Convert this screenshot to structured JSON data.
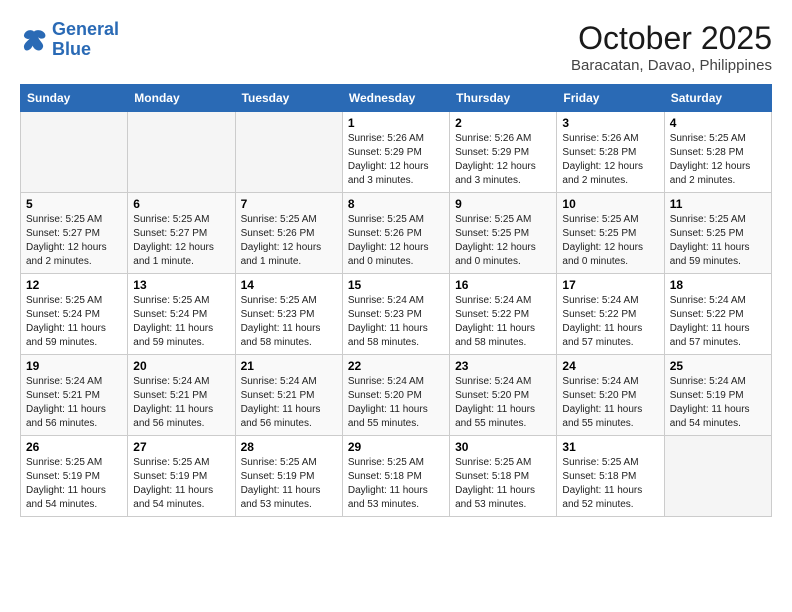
{
  "logo": {
    "line1": "General",
    "line2": "Blue"
  },
  "title": "October 2025",
  "location": "Baracatan, Davao, Philippines",
  "weekdays": [
    "Sunday",
    "Monday",
    "Tuesday",
    "Wednesday",
    "Thursday",
    "Friday",
    "Saturday"
  ],
  "weeks": [
    [
      {
        "day": "",
        "empty": true
      },
      {
        "day": "",
        "empty": true
      },
      {
        "day": "",
        "empty": true
      },
      {
        "day": "1",
        "sunrise": "5:26 AM",
        "sunset": "5:29 PM",
        "daylight": "12 hours and 3 minutes."
      },
      {
        "day": "2",
        "sunrise": "5:26 AM",
        "sunset": "5:29 PM",
        "daylight": "12 hours and 3 minutes."
      },
      {
        "day": "3",
        "sunrise": "5:26 AM",
        "sunset": "5:28 PM",
        "daylight": "12 hours and 2 minutes."
      },
      {
        "day": "4",
        "sunrise": "5:25 AM",
        "sunset": "5:28 PM",
        "daylight": "12 hours and 2 minutes."
      }
    ],
    [
      {
        "day": "5",
        "sunrise": "5:25 AM",
        "sunset": "5:27 PM",
        "daylight": "12 hours and 2 minutes."
      },
      {
        "day": "6",
        "sunrise": "5:25 AM",
        "sunset": "5:27 PM",
        "daylight": "12 hours and 1 minute."
      },
      {
        "day": "7",
        "sunrise": "5:25 AM",
        "sunset": "5:26 PM",
        "daylight": "12 hours and 1 minute."
      },
      {
        "day": "8",
        "sunrise": "5:25 AM",
        "sunset": "5:26 PM",
        "daylight": "12 hours and 0 minutes."
      },
      {
        "day": "9",
        "sunrise": "5:25 AM",
        "sunset": "5:25 PM",
        "daylight": "12 hours and 0 minutes."
      },
      {
        "day": "10",
        "sunrise": "5:25 AM",
        "sunset": "5:25 PM",
        "daylight": "12 hours and 0 minutes."
      },
      {
        "day": "11",
        "sunrise": "5:25 AM",
        "sunset": "5:25 PM",
        "daylight": "11 hours and 59 minutes."
      }
    ],
    [
      {
        "day": "12",
        "sunrise": "5:25 AM",
        "sunset": "5:24 PM",
        "daylight": "11 hours and 59 minutes."
      },
      {
        "day": "13",
        "sunrise": "5:25 AM",
        "sunset": "5:24 PM",
        "daylight": "11 hours and 59 minutes."
      },
      {
        "day": "14",
        "sunrise": "5:25 AM",
        "sunset": "5:23 PM",
        "daylight": "11 hours and 58 minutes."
      },
      {
        "day": "15",
        "sunrise": "5:24 AM",
        "sunset": "5:23 PM",
        "daylight": "11 hours and 58 minutes."
      },
      {
        "day": "16",
        "sunrise": "5:24 AM",
        "sunset": "5:22 PM",
        "daylight": "11 hours and 58 minutes."
      },
      {
        "day": "17",
        "sunrise": "5:24 AM",
        "sunset": "5:22 PM",
        "daylight": "11 hours and 57 minutes."
      },
      {
        "day": "18",
        "sunrise": "5:24 AM",
        "sunset": "5:22 PM",
        "daylight": "11 hours and 57 minutes."
      }
    ],
    [
      {
        "day": "19",
        "sunrise": "5:24 AM",
        "sunset": "5:21 PM",
        "daylight": "11 hours and 56 minutes."
      },
      {
        "day": "20",
        "sunrise": "5:24 AM",
        "sunset": "5:21 PM",
        "daylight": "11 hours and 56 minutes."
      },
      {
        "day": "21",
        "sunrise": "5:24 AM",
        "sunset": "5:21 PM",
        "daylight": "11 hours and 56 minutes."
      },
      {
        "day": "22",
        "sunrise": "5:24 AM",
        "sunset": "5:20 PM",
        "daylight": "11 hours and 55 minutes."
      },
      {
        "day": "23",
        "sunrise": "5:24 AM",
        "sunset": "5:20 PM",
        "daylight": "11 hours and 55 minutes."
      },
      {
        "day": "24",
        "sunrise": "5:24 AM",
        "sunset": "5:20 PM",
        "daylight": "11 hours and 55 minutes."
      },
      {
        "day": "25",
        "sunrise": "5:24 AM",
        "sunset": "5:19 PM",
        "daylight": "11 hours and 54 minutes."
      }
    ],
    [
      {
        "day": "26",
        "sunrise": "5:25 AM",
        "sunset": "5:19 PM",
        "daylight": "11 hours and 54 minutes."
      },
      {
        "day": "27",
        "sunrise": "5:25 AM",
        "sunset": "5:19 PM",
        "daylight": "11 hours and 54 minutes."
      },
      {
        "day": "28",
        "sunrise": "5:25 AM",
        "sunset": "5:19 PM",
        "daylight": "11 hours and 53 minutes."
      },
      {
        "day": "29",
        "sunrise": "5:25 AM",
        "sunset": "5:18 PM",
        "daylight": "11 hours and 53 minutes."
      },
      {
        "day": "30",
        "sunrise": "5:25 AM",
        "sunset": "5:18 PM",
        "daylight": "11 hours and 53 minutes."
      },
      {
        "day": "31",
        "sunrise": "5:25 AM",
        "sunset": "5:18 PM",
        "daylight": "11 hours and 52 minutes."
      },
      {
        "day": "",
        "empty": true
      }
    ]
  ]
}
